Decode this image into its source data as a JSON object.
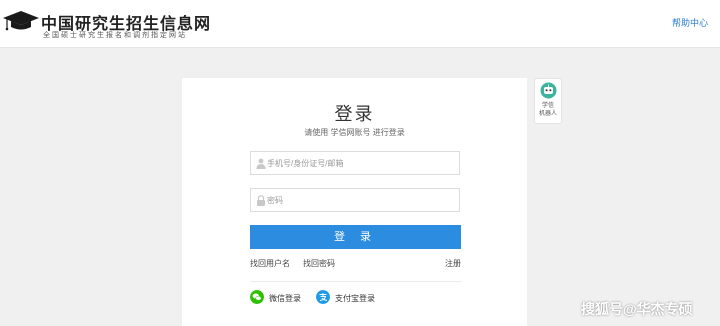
{
  "header": {
    "title": "中国研究生招生信息网",
    "subtitle": "全国硕士研究生报名和调剂指定网站",
    "help_link": "帮助中心"
  },
  "login": {
    "title": "登录",
    "subtitle": "请使用 学信网账号 进行登录",
    "username_placeholder": "手机号/身份证号/邮箱",
    "password_placeholder": "密码",
    "submit_label": "登 录",
    "links": {
      "find_username": "找回用户名",
      "find_password": "找回密码",
      "register": "注册"
    },
    "social": [
      {
        "label": "微信登录",
        "icon": "wechat-icon",
        "color": "#2dc100"
      },
      {
        "label": "支付宝登录",
        "icon": "alipay-icon",
        "color": "#1e9be8"
      }
    ]
  },
  "robot": {
    "label_line1": "学信",
    "label_line2": "机器人"
  },
  "watermark": "搜狐号@华杰专硕",
  "colors": {
    "accent": "#2c8ce0",
    "link": "#2a7bd0",
    "background": "#f0f0f0"
  }
}
